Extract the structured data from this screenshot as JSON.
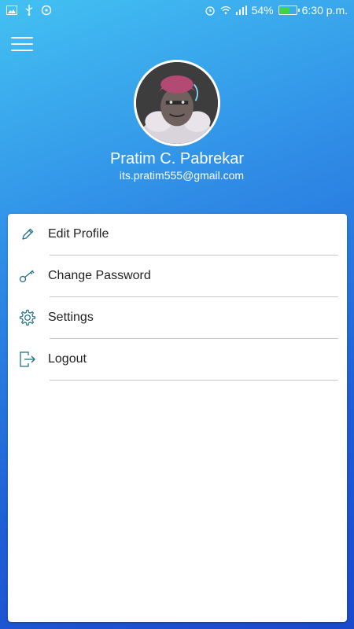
{
  "status_bar": {
    "battery_percent": "54%",
    "battery_level": 0.54,
    "time": "6:30 p.m.",
    "icons": [
      "image-icon",
      "usb-icon",
      "sync-icon",
      "alarm-icon",
      "wifi-icon",
      "signal-icon",
      "battery-icon"
    ]
  },
  "colors": {
    "gradient_top": "#43c1f2",
    "gradient_bottom": "#1a49cc",
    "icon_color": "#1f6f8b",
    "text_color": "#222222"
  },
  "profile": {
    "name": "Pratim C. Pabrekar",
    "email": "its.pratim555@gmail.com"
  },
  "menu": {
    "items": [
      {
        "label": "Edit Profile",
        "icon": "pencil-icon"
      },
      {
        "label": "Change Password",
        "icon": "key-icon"
      },
      {
        "label": "Settings",
        "icon": "gear-icon"
      },
      {
        "label": "Logout",
        "icon": "logout-icon"
      }
    ]
  }
}
